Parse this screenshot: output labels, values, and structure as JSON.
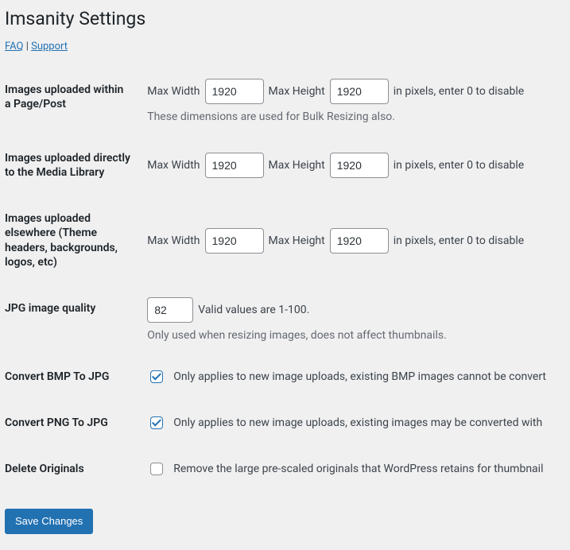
{
  "page": {
    "title": "Imsanity Settings",
    "links": {
      "faq": "FAQ",
      "sep": " | ",
      "support": "Support"
    }
  },
  "labels": {
    "max_width": "Max Width",
    "max_height": "Max Height",
    "px_hint": "in pixels, enter 0 to disable"
  },
  "rows": {
    "within_post": {
      "heading": "Images uploaded within a Page/Post",
      "width": "1920",
      "height": "1920",
      "description": "These dimensions are used for Bulk Resizing also."
    },
    "media_library": {
      "heading": "Images uploaded directly to the Media Library",
      "width": "1920",
      "height": "1920"
    },
    "elsewhere": {
      "heading": "Images uploaded elsewhere (Theme headers, backgrounds, logos, etc)",
      "width": "1920",
      "height": "1920"
    },
    "jpg_quality": {
      "heading": "JPG image quality",
      "value": "82",
      "hint": "Valid values are 1-100.",
      "description": "Only used when resizing images, does not affect thumbnails."
    },
    "bmp_to_jpg": {
      "heading": "Convert BMP To JPG",
      "checked": true,
      "label": "Only applies to new image uploads, existing BMP images cannot be convert"
    },
    "png_to_jpg": {
      "heading": "Convert PNG To JPG",
      "checked": true,
      "label": "Only applies to new image uploads, existing images may be converted with "
    },
    "delete_originals": {
      "heading": "Delete Originals",
      "checked": false,
      "label": "Remove the large pre-scaled originals that WordPress retains for thumbnail"
    }
  },
  "submit": {
    "label": "Save Changes"
  }
}
